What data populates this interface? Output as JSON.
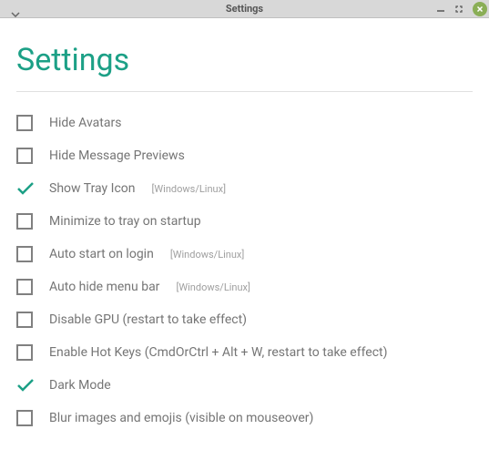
{
  "window": {
    "title": "Settings"
  },
  "page": {
    "title": "Settings"
  },
  "settings": [
    {
      "label": "Hide Avatars",
      "checked": false,
      "note": ""
    },
    {
      "label": "Hide Message Previews",
      "checked": false,
      "note": ""
    },
    {
      "label": "Show Tray Icon",
      "checked": true,
      "note": "[Windows/Linux]"
    },
    {
      "label": "Minimize to tray on startup",
      "checked": false,
      "note": ""
    },
    {
      "label": "Auto start on login",
      "checked": false,
      "note": "[Windows/Linux]"
    },
    {
      "label": "Auto hide menu bar",
      "checked": false,
      "note": "[Windows/Linux]"
    },
    {
      "label": "Disable GPU (restart to take effect)",
      "checked": false,
      "note": ""
    },
    {
      "label": "Enable Hot Keys (CmdOrCtrl + Alt + W, restart to take effect)",
      "checked": false,
      "note": ""
    },
    {
      "label": "Dark Mode",
      "checked": true,
      "note": ""
    },
    {
      "label": "Blur images and emojis (visible on mouseover)",
      "checked": false,
      "note": ""
    }
  ]
}
